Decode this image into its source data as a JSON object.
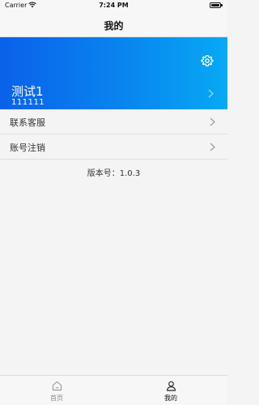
{
  "status_bar": {
    "carrier": "Carrier",
    "time": "7:24 PM",
    "icons": [
      "wifi-icon",
      "battery-icon"
    ]
  },
  "nav": {
    "title": "我的"
  },
  "profile": {
    "name": "测试1",
    "id": "111111",
    "settings_icon": "gear-icon",
    "chevron_icon": "chevron-right-icon",
    "gradient": [
      "#0a61ea",
      "#07a9f4"
    ]
  },
  "menu": {
    "items": [
      {
        "label": "联系客服",
        "icon": "chevron-right-icon"
      },
      {
        "label": "账号注销",
        "icon": "chevron-right-icon"
      }
    ]
  },
  "version": {
    "text": "版本号：1.0.3"
  },
  "tab_bar": {
    "items": [
      {
        "label": "首页",
        "icon": "home-icon",
        "active": false
      },
      {
        "label": "我的",
        "icon": "person-icon",
        "active": true
      }
    ],
    "active_color": "#111111",
    "inactive_color": "#8a8a8a"
  }
}
